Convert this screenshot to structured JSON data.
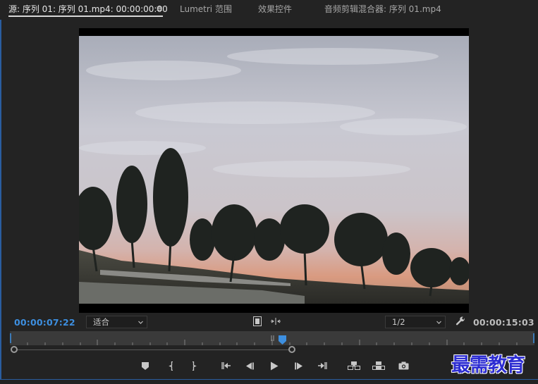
{
  "tabs": [
    {
      "label": "源: 序列 01: 序列 01.mp4: 00:00:00:00",
      "active": true
    },
    {
      "label": "Lumetri 范围",
      "active": false
    },
    {
      "label": "效果控件",
      "active": false
    },
    {
      "label": "音频剪辑混合器: 序列 01.mp4",
      "active": false
    }
  ],
  "tab_menu_icon": "hamburger-menu-icon",
  "monitor": {
    "current_timecode": "00:00:07:22",
    "duration_timecode": "00:00:15:03",
    "zoom_select": {
      "value": "适合"
    },
    "resolution_select": {
      "value": "1/2"
    },
    "playhead_position_fraction": 0.52,
    "zoom_range_fraction": [
      0.0,
      0.53
    ]
  },
  "icons": {
    "export_frame_settings": "film-strip-icon",
    "safe_margins": "arrows-in-icon",
    "settings": "wrench-icon"
  },
  "transport_buttons": [
    {
      "name": "add-marker-button",
      "icon": "marker-icon"
    },
    {
      "name": "mark-in-button",
      "icon": "brace-open-icon"
    },
    {
      "name": "mark-out-button",
      "icon": "brace-close-icon"
    },
    {
      "name": "go-to-in-button",
      "icon": "go-to-in-icon"
    },
    {
      "name": "step-back-button",
      "icon": "step-back-icon"
    },
    {
      "name": "play-button",
      "icon": "play-icon"
    },
    {
      "name": "step-forward-button",
      "icon": "step-forward-icon"
    },
    {
      "name": "go-to-out-button",
      "icon": "go-to-out-icon"
    },
    {
      "name": "insert-button",
      "icon": "insert-icon"
    },
    {
      "name": "overwrite-button",
      "icon": "overwrite-icon"
    },
    {
      "name": "export-frame-button",
      "icon": "camera-icon"
    }
  ],
  "colors": {
    "timecode_accent": "#3d8fe0",
    "playhead": "#3d8fe0",
    "panel_focus_border": "#2a5d9f"
  },
  "watermark": {
    "text": "最需教育"
  }
}
